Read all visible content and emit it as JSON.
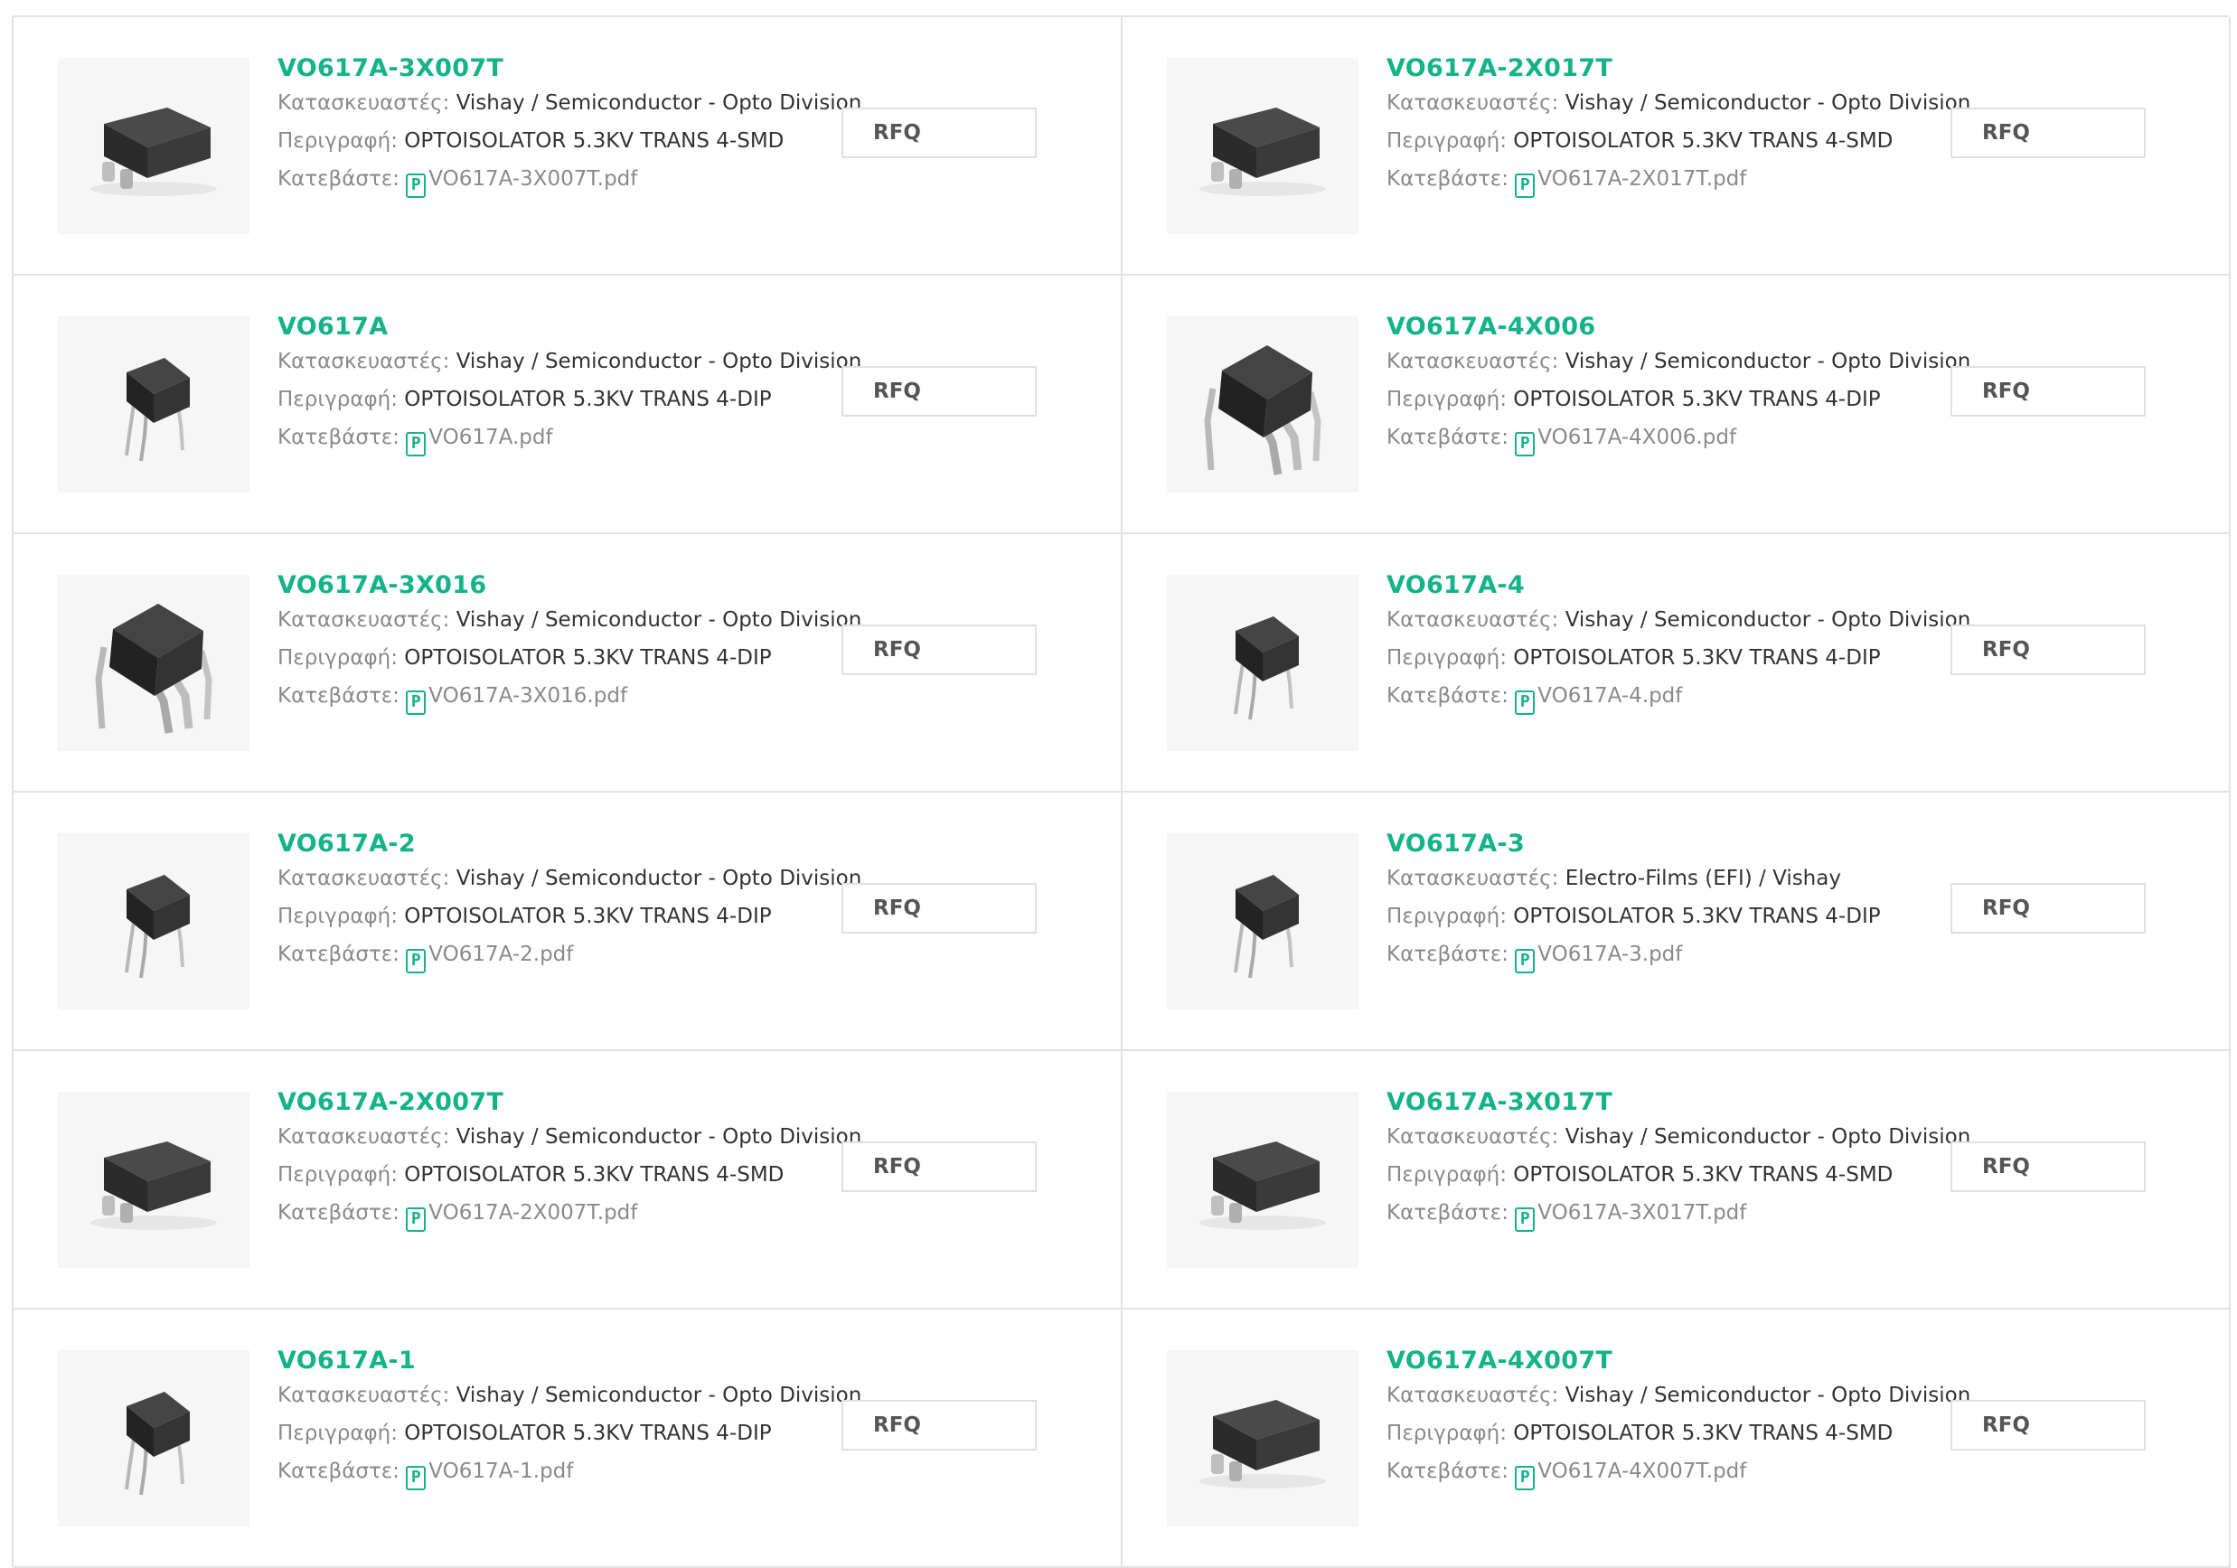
{
  "labels": {
    "manufacturer": "Κατασκευαστές:",
    "description": "Περιγραφή:",
    "download": "Κατεβάστε:",
    "rfq": "RFQ",
    "pdf_icon": "P"
  },
  "icons": {
    "pdf": "pdf-file-icon",
    "accent": "#14b38a"
  },
  "products": [
    {
      "name": "VO617A-3X007T",
      "package": "smd",
      "manufacturer": "Vishay / Semiconductor - Opto Division",
      "description": "OPTOISOLATOR 5.3KV TRANS 4-SMD",
      "file": "VO617A-3X007T.pdf"
    },
    {
      "name": "VO617A-2X017T",
      "package": "smd",
      "manufacturer": "Vishay / Semiconductor - Opto Division",
      "description": "OPTOISOLATOR 5.3KV TRANS 4-SMD",
      "file": "VO617A-2X017T.pdf"
    },
    {
      "name": "VO617A",
      "package": "dip",
      "manufacturer": "Vishay / Semiconductor - Opto Division",
      "description": "OPTOISOLATOR 5.3KV TRANS 4-DIP",
      "file": "VO617A.pdf"
    },
    {
      "name": "VO617A-4X006",
      "package": "dip-large",
      "manufacturer": "Vishay / Semiconductor - Opto Division",
      "description": "OPTOISOLATOR 5.3KV TRANS 4-DIP",
      "file": "VO617A-4X006.pdf"
    },
    {
      "name": "VO617A-3X016",
      "package": "dip-large",
      "manufacturer": "Vishay / Semiconductor - Opto Division",
      "description": "OPTOISOLATOR 5.3KV TRANS 4-DIP",
      "file": "VO617A-3X016.pdf"
    },
    {
      "name": "VO617A-4",
      "package": "dip",
      "manufacturer": "Vishay / Semiconductor - Opto Division",
      "description": "OPTOISOLATOR 5.3KV TRANS 4-DIP",
      "file": "VO617A-4.pdf"
    },
    {
      "name": "VO617A-2",
      "package": "dip",
      "manufacturer": "Vishay / Semiconductor - Opto Division",
      "description": "OPTOISOLATOR 5.3KV TRANS 4-DIP",
      "file": "VO617A-2.pdf"
    },
    {
      "name": "VO617A-3",
      "package": "dip",
      "manufacturer": "Electro-Films (EFI) / Vishay",
      "description": "OPTOISOLATOR 5.3KV TRANS 4-DIP",
      "file": "VO617A-3.pdf"
    },
    {
      "name": "VO617A-2X007T",
      "package": "smd",
      "manufacturer": "Vishay / Semiconductor - Opto Division",
      "description": "OPTOISOLATOR 5.3KV TRANS 4-SMD",
      "file": "VO617A-2X007T.pdf"
    },
    {
      "name": "VO617A-3X017T",
      "package": "smd",
      "manufacturer": "Vishay / Semiconductor - Opto Division",
      "description": "OPTOISOLATOR 5.3KV TRANS 4-SMD",
      "file": "VO617A-3X017T.pdf"
    },
    {
      "name": "VO617A-1",
      "package": "dip",
      "manufacturer": "Vishay / Semiconductor - Opto Division",
      "description": "OPTOISOLATOR 5.3KV TRANS 4-DIP",
      "file": "VO617A-1.pdf"
    },
    {
      "name": "VO617A-4X007T",
      "package": "smd",
      "manufacturer": "Vishay / Semiconductor - Opto Division",
      "description": "OPTOISOLATOR 5.3KV TRANS 4-SMD",
      "file": "VO617A-4X007T.pdf"
    }
  ]
}
